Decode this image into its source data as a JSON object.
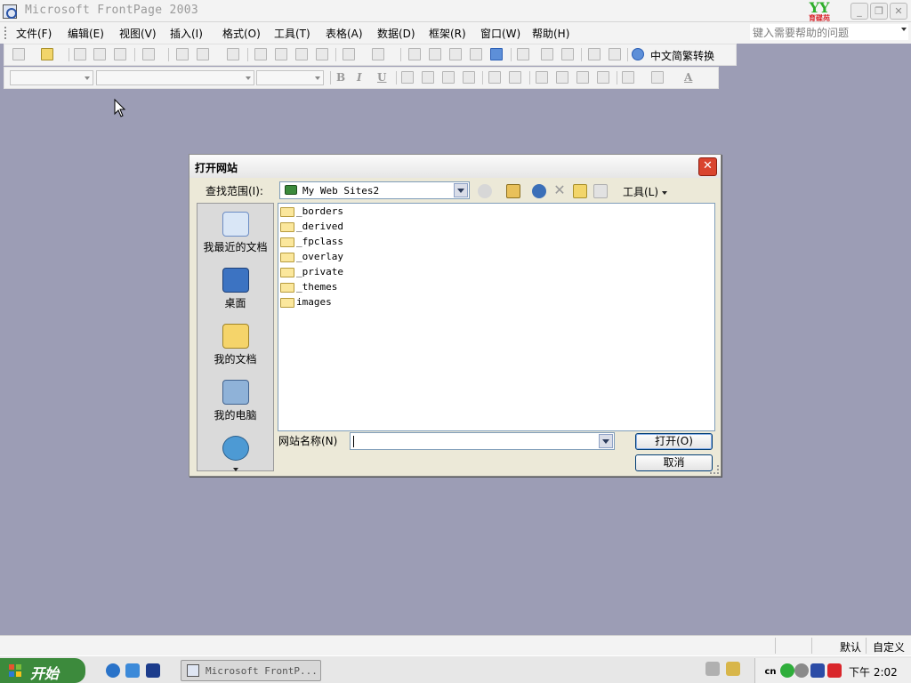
{
  "window": {
    "title": "Microsoft FrontPage 2003",
    "brand": "YY",
    "brand_sub": "育碟苑",
    "minimize": "_",
    "maximize": "❐",
    "close": "✕"
  },
  "menubar": {
    "items": [
      "文件(F)",
      "编辑(E)",
      "视图(V)",
      "插入(I)",
      "格式(O)",
      "工具(T)",
      "表格(A)",
      "数据(D)",
      "框架(R)",
      "窗口(W)",
      "帮助(H)"
    ],
    "help_placeholder": "键入需要帮助的问题"
  },
  "toolbar": {
    "zh_convert": "中文简繁转换",
    "bold": "B",
    "italic": "I",
    "underline": "U",
    "font_color": "A"
  },
  "dialog": {
    "title": "打开网站",
    "close": "✕",
    "look_in_label": "查找范围(I):",
    "look_in_value": "My Web Sites2",
    "tools_label": "工具(L)",
    "places": [
      {
        "label": "我最近的文档",
        "icon": "recent-documents-icon"
      },
      {
        "label": "桌面",
        "icon": "desktop-icon"
      },
      {
        "label": "我的文档",
        "icon": "my-documents-icon"
      },
      {
        "label": "我的电脑",
        "icon": "my-computer-icon"
      },
      {
        "label": "",
        "icon": "network-places-icon"
      }
    ],
    "files": [
      "_borders",
      "_derived",
      "_fpclass",
      "_overlay",
      "_private",
      "_themes",
      "images"
    ],
    "site_name_label": "网站名称(N)",
    "site_name_value": "",
    "open_button": "打开(O)",
    "cancel_button": "取消"
  },
  "statusbar": {
    "default": "默认",
    "custom": "自定义"
  },
  "taskbar": {
    "start": "开始",
    "task_label": "Microsoft FrontP...",
    "tray_lang": "cn",
    "clock": "下午 2:02"
  }
}
